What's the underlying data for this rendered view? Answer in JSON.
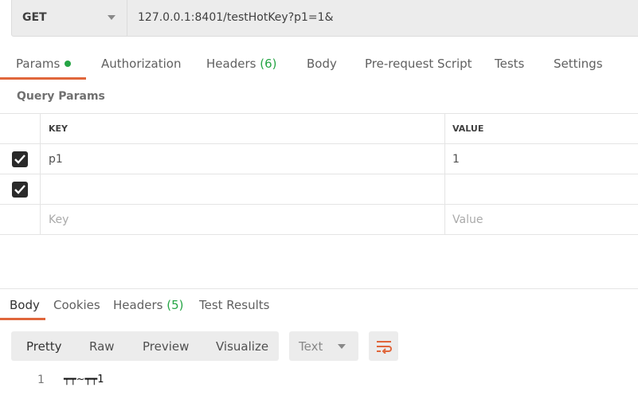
{
  "request": {
    "method": "GET",
    "url": "127.0.0.1:8401/testHotKey?p1=1&"
  },
  "request_tabs": [
    {
      "label": "Params"
    },
    {
      "label": "Authorization"
    },
    {
      "label": "Headers",
      "count": "(6)"
    },
    {
      "label": "Body"
    },
    {
      "label": "Pre-request Script"
    },
    {
      "label": "Tests"
    },
    {
      "label": "Settings"
    }
  ],
  "query_params": {
    "title": "Query Params",
    "columns": [
      "KEY",
      "VALUE"
    ],
    "rows": [
      {
        "checked": true,
        "key": "p1",
        "value": "1"
      },
      {
        "checked": true,
        "key": "",
        "value": ""
      }
    ],
    "placeholder": {
      "key": "Key",
      "value": "Value"
    }
  },
  "response_tabs": [
    {
      "label": "Body"
    },
    {
      "label": "Cookies"
    },
    {
      "label": "Headers",
      "count": "(5)"
    },
    {
      "label": "Test Results"
    }
  ],
  "view_modes": [
    "Pretty",
    "Raw",
    "Preview",
    "Visualize"
  ],
  "format": "Text",
  "body_lines": [
    {
      "num": "1",
      "text": "┯┯~┯┯1"
    }
  ],
  "colors": {
    "accent": "#e0663b",
    "green": "#26a545"
  }
}
